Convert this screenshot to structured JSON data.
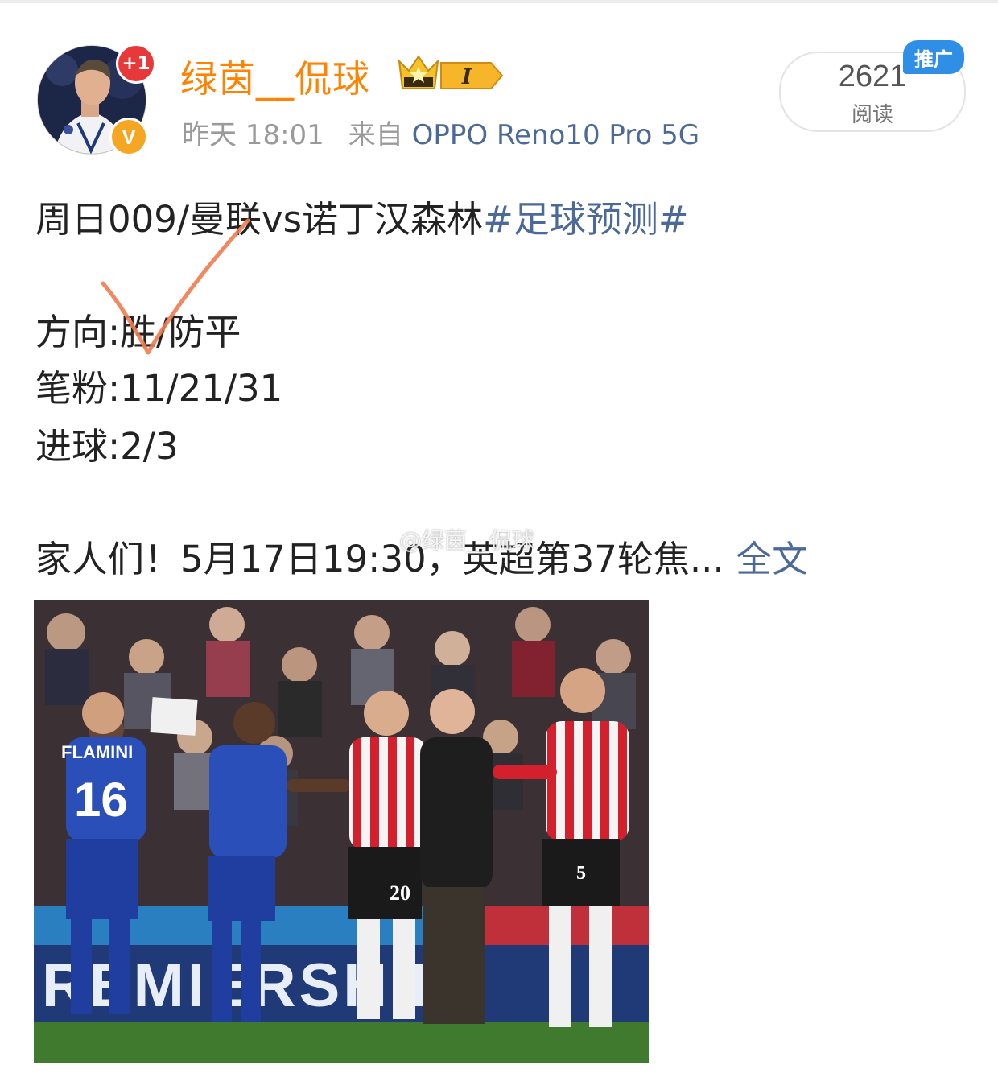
{
  "post_header": {
    "username": "绿茵__侃球",
    "notification_count": "+1",
    "verified_mark": "V",
    "member_level": "I",
    "timestamp": "昨天 18:01",
    "source_prefix": "来自",
    "device": "OPPO Reno10 Pro 5G",
    "read_count": "2621",
    "read_label": "阅读",
    "promo_tag": "推广"
  },
  "post_body": {
    "line1_text": "周日009/曼联vs诺丁汉森林",
    "hashtag": "#足球预测#",
    "direction": "方向:胜/防平",
    "scores": "笔粉:11/21/31",
    "goals": "进球:2/3",
    "teaser": "家人们！5月17日19:30，英超第37轮焦...",
    "full_text_link": "全文",
    "watermark": "@绿茵__侃球"
  },
  "photo": {
    "player_name": "FLAMINI",
    "number_16": "16",
    "number_20": "20",
    "number_5": "5",
    "board_text": "REMIERSHIP"
  },
  "colors": {
    "username": "#ff8200",
    "link": "#4b6a9a",
    "check_mark": "#f07b4f",
    "promo": "#2f8fe6"
  }
}
